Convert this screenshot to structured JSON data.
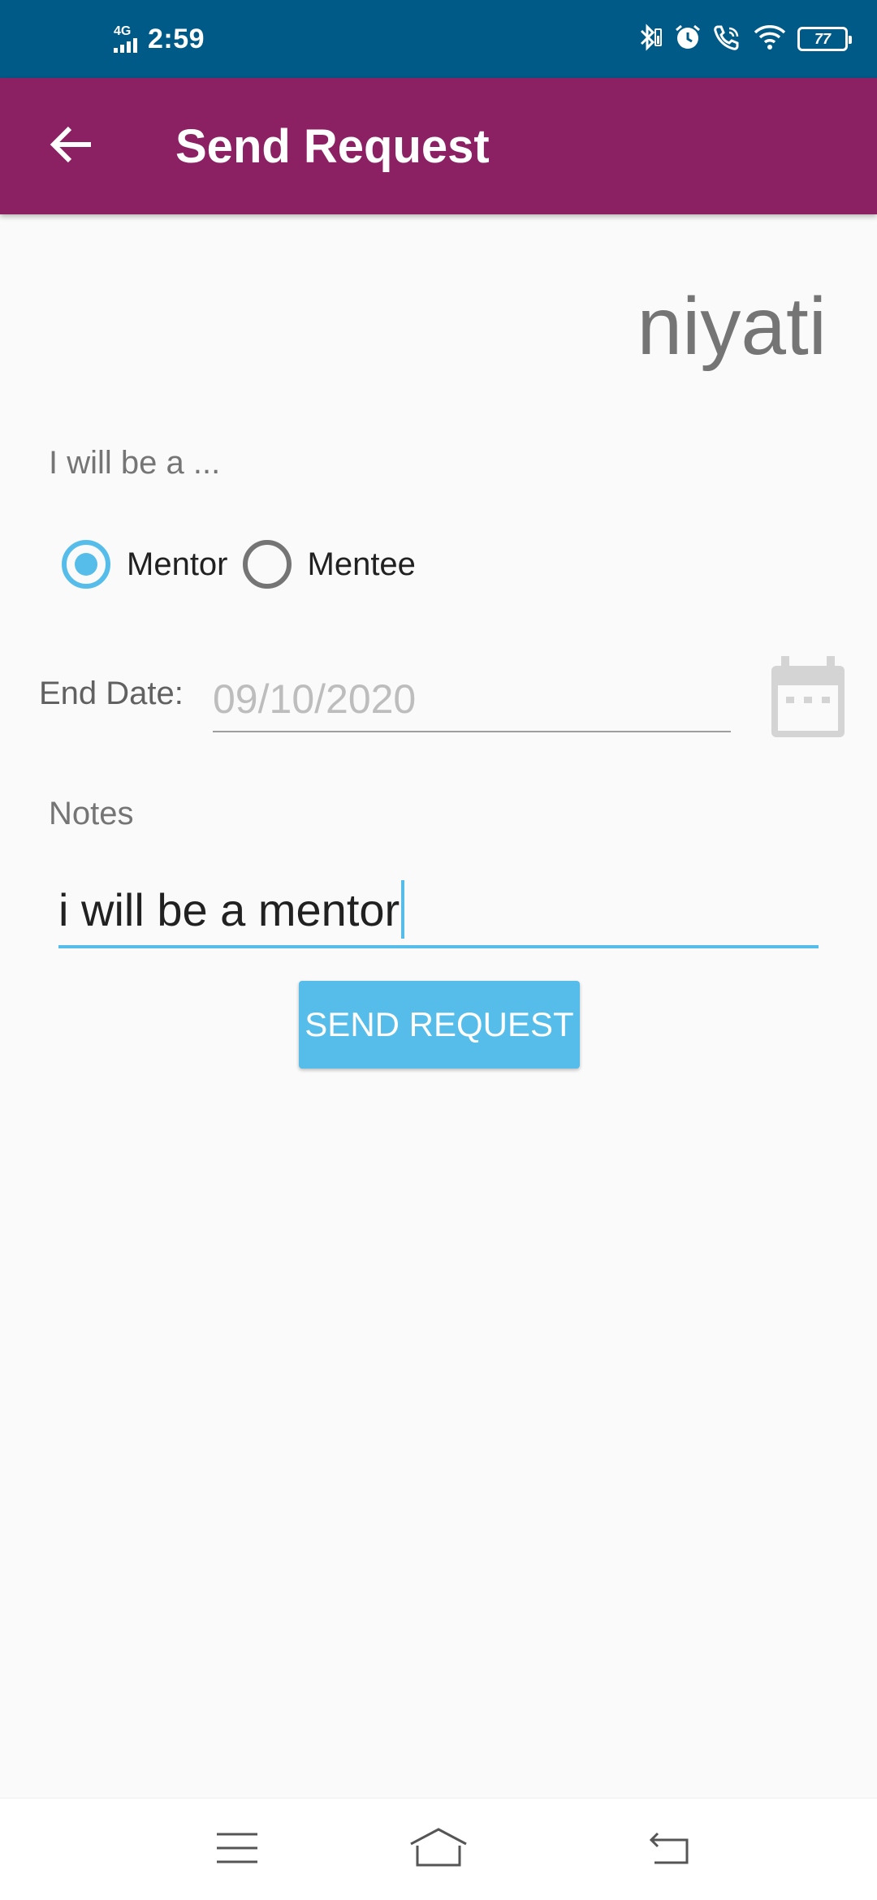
{
  "status_bar": {
    "network": "4G",
    "time": "2:59",
    "battery": "77",
    "icons": [
      "signal-icon",
      "bluetooth-icon",
      "alarm-icon",
      "wifi-calling-icon",
      "wifi-icon",
      "battery-icon"
    ]
  },
  "app_bar": {
    "title": "Send Request",
    "back_icon": "arrow-left-icon"
  },
  "form": {
    "name": "niyati",
    "role_prompt": "I will be a ...",
    "roles": [
      {
        "label": "Mentor",
        "selected": true
      },
      {
        "label": "Mentee",
        "selected": false
      }
    ],
    "end_date_label": "End Date:",
    "end_date_value": "09/10/2020",
    "calendar_icon": "calendar-icon",
    "notes_label": "Notes",
    "notes_value": "i will be a mentor",
    "submit_label": "SEND REQUEST"
  },
  "nav_bar": {
    "buttons": [
      "menu-icon",
      "home-icon",
      "back-icon"
    ]
  },
  "colors": {
    "status_bar": "#005a87",
    "app_bar": "#8b2163",
    "accent": "#56bdea",
    "background": "#fafafa"
  }
}
